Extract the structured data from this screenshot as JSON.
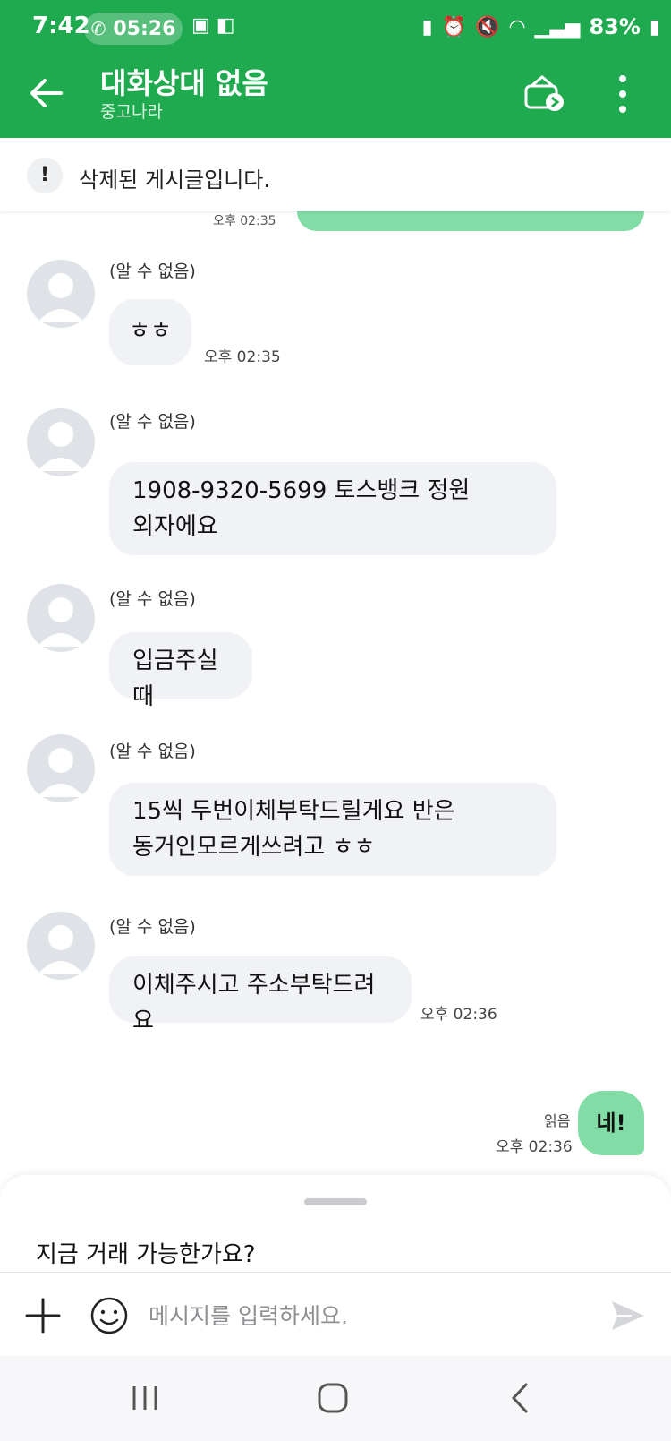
{
  "status_bar": {
    "time": "7:42",
    "call_timer": "05:26",
    "battery": "83%"
  },
  "header": {
    "title": "대화상대 없음",
    "subtitle": "중고나라"
  },
  "notice": {
    "text": "삭제된 게시글입니다."
  },
  "chat": {
    "previous_time": "오후 02:35",
    "messages": [
      {
        "sender": "(알 수 없음)",
        "text": "ㅎㅎ",
        "time": "오후 02:35"
      },
      {
        "sender": "(알 수 없음)",
        "text": "1908-9320-5699 토스뱅크 정원\n외자에요",
        "time": ""
      },
      {
        "sender": "(알 수 없음)",
        "text": "입금주실때",
        "time": ""
      },
      {
        "sender": "(알 수 없음)",
        "text": "15씩 두번이체부탁드릴게요 반은\n동거인모르게쓰려고 ㅎㅎ",
        "time": ""
      },
      {
        "sender": "(알 수 없음)",
        "text": "이체주시고 주소부탁드려요",
        "time": "오후 02:36"
      }
    ],
    "my_message": {
      "text": "네!",
      "read_label": "읽음",
      "time": "오후 02:36"
    }
  },
  "suggestion": {
    "text": "지금 거래 가능한가요?"
  },
  "composer": {
    "placeholder": "메시지를 입력하세요."
  },
  "colors": {
    "brand_green": "#1faa4f",
    "my_bubble": "#82dca5",
    "other_bubble": "#f1f2f5"
  }
}
